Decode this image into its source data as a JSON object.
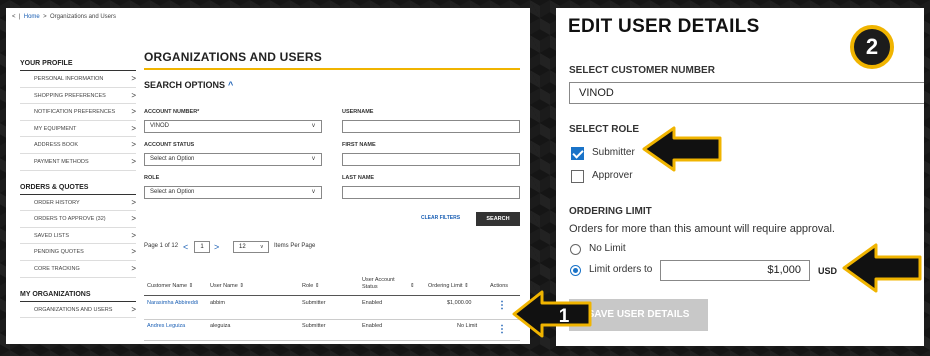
{
  "breadcrumb": {
    "back": "<",
    "home": "Home",
    "sep": ">",
    "current": "Organizations and Users"
  },
  "sidebar": {
    "profile_heading": "YOUR PROFILE",
    "profile_items": [
      "Personal Information",
      "Shopping Preferences",
      "Notification Preferences",
      "My Equipment",
      "Address Book",
      "Payment Methods"
    ],
    "orders_heading": "ORDERS & QUOTES",
    "orders_items": [
      "Order History",
      "Orders to Approve (32)",
      "Saved Lists",
      "Pending Quotes",
      "Core Tracking"
    ],
    "org_heading": "MY ORGANIZATIONS",
    "org_items": [
      "Organizations and Users"
    ],
    "chevron": ">"
  },
  "main": {
    "title": "ORGANIZATIONS AND USERS",
    "search_options": "SEARCH OPTIONS",
    "search_caret": "^",
    "account_number_label": "ACCOUNT NUMBER*",
    "account_number_value": "VINOD",
    "username_label": "USERNAME",
    "account_status_label": "ACCOUNT STATUS",
    "account_status_value": "Select an Option",
    "first_name_label": "FIRST NAME",
    "role_label": "ROLE",
    "role_value": "Select an Option",
    "last_name_label": "LAST NAME",
    "dropdown_glyph": "v",
    "clear_filters": "CLEAR FILTERS",
    "search_button": "SEARCH",
    "pagination": {
      "text": "Page 1 of 12",
      "prev": "<",
      "page": "1",
      "next": ">",
      "per_page_value": "12",
      "per_page_glyph": "v",
      "per_page_label": "Items Per Page"
    },
    "columns": [
      "Customer Name",
      "User Name",
      "Role",
      "User Account Status",
      "Ordering Limit",
      "Actions"
    ],
    "sort_glyph": "⇕",
    "rows": [
      {
        "customer": "Narasimha Abbireddi",
        "username": "abbim",
        "role": "Submitter",
        "status": "Enabled",
        "limit": "$1,000.00"
      },
      {
        "customer": "Andres Leguiza",
        "username": "aleguiza",
        "role": "Submitter",
        "status": "Enabled",
        "limit": "No Limit"
      }
    ],
    "kebab": "⋮"
  },
  "edit": {
    "title": "EDIT USER DETAILS",
    "customer_number_label": "SELECT CUSTOMER NUMBER",
    "customer_number_value": "VINOD",
    "role_label": "SELECT ROLE",
    "roles": [
      {
        "label": "Submitter",
        "checked": true
      },
      {
        "label": "Approver",
        "checked": false
      }
    ],
    "ordering_limit_label": "ORDERING LIMIT",
    "ordering_note": "Orders for more than this amount will require approval.",
    "no_limit": "No Limit",
    "limit_orders": "Limit orders to",
    "amount": "$1,000",
    "currency": "USD",
    "save_button": "SAVE USER DETAILS"
  },
  "callouts": {
    "step1": "1",
    "step2": "2"
  },
  "colors": {
    "accent": "#f0b400",
    "link": "#1a5fb4",
    "checkbox": "#1a73c8",
    "button": "#333333",
    "save_disabled": "#c8c8c8"
  }
}
